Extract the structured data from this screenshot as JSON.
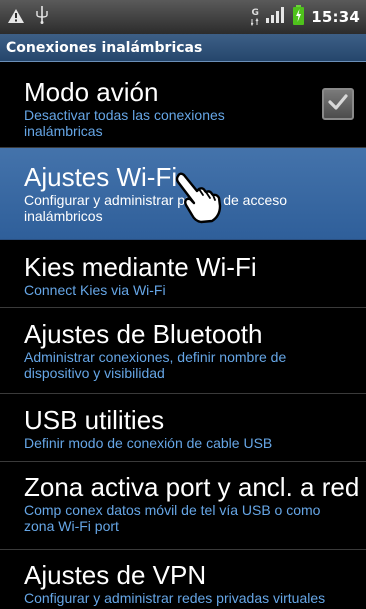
{
  "status_bar": {
    "time": "15:34",
    "network_label": "G",
    "icons": [
      "warning-icon",
      "usb-icon",
      "network-type-icon",
      "signal-icon",
      "battery-charging-icon"
    ]
  },
  "header": {
    "title": "Conexiones inalámbricas"
  },
  "settings": {
    "items": [
      {
        "title": "Modo avión",
        "subtitle": "Desactivar todas las conexiones inalámbricas",
        "checkbox": true,
        "checked": true
      },
      {
        "title": "Ajustes Wi-Fi",
        "subtitle": "Configurar y administrar puntos de acceso inalámbricos",
        "selected": true
      },
      {
        "title": "Kies mediante Wi-Fi",
        "subtitle": "Connect Kies via Wi-Fi"
      },
      {
        "title": "Ajustes de Bluetooth",
        "subtitle": "Administrar conexiones, definir nombre de dispositivo y visibilidad"
      },
      {
        "title": "USB utilities",
        "subtitle": "Definir modo de conexión de cable USB"
      },
      {
        "title": "Zona activa port y ancl. a red",
        "subtitle": "Comp conex datos móvil de tel vía USB o como zona Wi-Fi port"
      },
      {
        "title": "Ajustes de VPN",
        "subtitle": "Configurar y administrar redes privadas virtuales"
      }
    ]
  },
  "colors": {
    "title_bar": "#2f507a",
    "selected_row": "#3b6aa3",
    "subtitle_text": "#66a6e6"
  }
}
